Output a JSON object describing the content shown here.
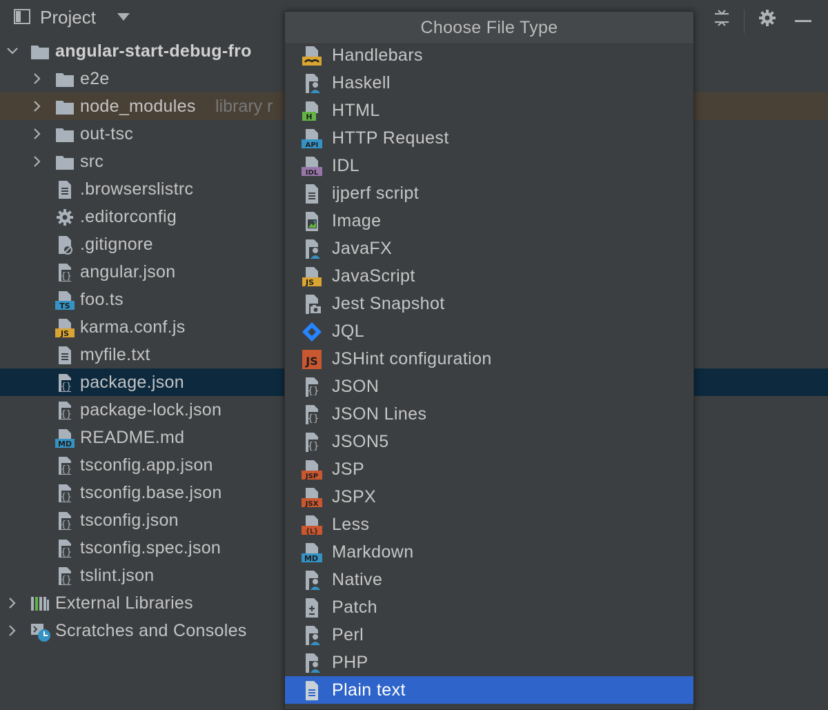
{
  "project_panel": {
    "title": "Project",
    "tree": [
      {
        "label": "angular-start-debug-fro",
        "type": "root-folder"
      },
      {
        "label": "e2e",
        "type": "folder"
      },
      {
        "label": "node_modules",
        "hint": "library r",
        "type": "folder"
      },
      {
        "label": "out-tsc",
        "type": "folder"
      },
      {
        "label": "src",
        "type": "folder"
      },
      {
        "label": ".browserslistrc",
        "type": "text-file"
      },
      {
        "label": ".editorconfig",
        "type": "config-file"
      },
      {
        "label": ".gitignore",
        "type": "ignore-file"
      },
      {
        "label": "angular.json",
        "type": "json-file"
      },
      {
        "label": "foo.ts",
        "type": "ts-file"
      },
      {
        "label": "karma.conf.js",
        "type": "js-file"
      },
      {
        "label": "myfile.txt",
        "type": "text-file"
      },
      {
        "label": "package.json",
        "type": "json-file"
      },
      {
        "label": "package-lock.json",
        "type": "json-file"
      },
      {
        "label": "README.md",
        "type": "md-file"
      },
      {
        "label": "tsconfig.app.json",
        "type": "json-file"
      },
      {
        "label": "tsconfig.base.json",
        "type": "json-file"
      },
      {
        "label": "tsconfig.json",
        "type": "json-file"
      },
      {
        "label": "tsconfig.spec.json",
        "type": "json-file"
      },
      {
        "label": "tslint.json",
        "type": "json-file"
      },
      {
        "label": "External Libraries",
        "type": "libraries"
      },
      {
        "label": "Scratches and Consoles",
        "type": "scratches"
      }
    ]
  },
  "popup": {
    "title": "Choose File Type",
    "items": [
      {
        "label": "Handlebars",
        "icon": "handlebars-icon"
      },
      {
        "label": "Haskell",
        "icon": "user-file-icon"
      },
      {
        "label": "HTML",
        "icon": "html-icon"
      },
      {
        "label": "HTTP Request",
        "icon": "api-icon"
      },
      {
        "label": "IDL",
        "icon": "idl-icon"
      },
      {
        "label": "ijperf script",
        "icon": "text-file-icon"
      },
      {
        "label": "Image",
        "icon": "image-file-icon"
      },
      {
        "label": "JavaFX",
        "icon": "user-file-icon"
      },
      {
        "label": "JavaScript",
        "icon": "js-file-icon"
      },
      {
        "label": "Jest Snapshot",
        "icon": "camera-file-icon"
      },
      {
        "label": "JQL",
        "icon": "jira-icon"
      },
      {
        "label": "JSHint configuration",
        "icon": "jshint-icon"
      },
      {
        "label": "JSON",
        "icon": "json-file-icon"
      },
      {
        "label": "JSON Lines",
        "icon": "json-file-icon"
      },
      {
        "label": "JSON5",
        "icon": "json-file-icon"
      },
      {
        "label": "JSP",
        "icon": "jsp-icon"
      },
      {
        "label": "JSPX",
        "icon": "jsx-icon"
      },
      {
        "label": "Less",
        "icon": "less-icon"
      },
      {
        "label": "Markdown",
        "icon": "md-file-icon"
      },
      {
        "label": "Native",
        "icon": "user-file-icon"
      },
      {
        "label": "Patch",
        "icon": "patch-file-icon"
      },
      {
        "label": "Perl",
        "icon": "user-file-icon"
      },
      {
        "label": "PHP",
        "icon": "user-file-icon"
      },
      {
        "label": "Plain text",
        "icon": "text-file-icon"
      }
    ],
    "selected_label": "Plain text"
  },
  "colors": {
    "background": "#3c3f41",
    "selection_popup": "#2f65ca",
    "selection_tree": "#0d293e",
    "library_row": "#4a4136"
  },
  "header_icons": [
    "collapse-all-icon",
    "gear-icon",
    "minimize-icon"
  ]
}
